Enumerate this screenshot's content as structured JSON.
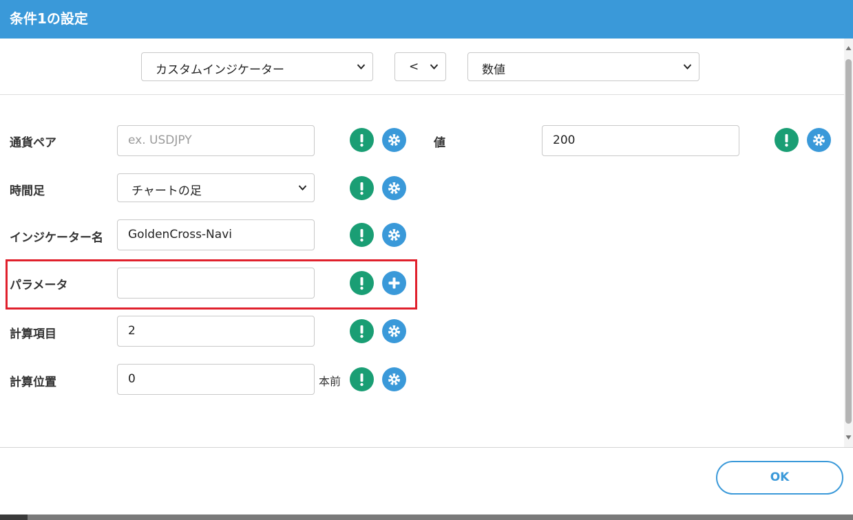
{
  "dialog": {
    "title": "条件1の設定"
  },
  "top_selects": {
    "indicator": "カスタムインジケーター",
    "operator": "<",
    "compare": "数値"
  },
  "left_rows": [
    {
      "label": "通貨ペア",
      "value": "",
      "placeholder": "ex. USDJPY",
      "type": "input",
      "action_icon": "gear-icon"
    },
    {
      "label": "時間足",
      "value": "チャートの足",
      "type": "select",
      "action_icon": "gear-icon"
    },
    {
      "label": "インジケーター名",
      "value": "GoldenCross-Navi",
      "type": "input",
      "action_icon": "gear-icon"
    },
    {
      "label": "パラメータ",
      "value": "",
      "type": "input",
      "action_icon": "plus-icon",
      "highlighted": true
    },
    {
      "label": "計算項目",
      "value": "2",
      "type": "input",
      "action_icon": "gear-icon"
    },
    {
      "label": "計算位置",
      "value": "0",
      "unit": "本前",
      "type": "input",
      "action_icon": "gear-icon"
    }
  ],
  "right_rows": [
    {
      "label": "値",
      "value": "200",
      "type": "input",
      "action_icon": "gear-icon"
    }
  ],
  "footer": {
    "ok_label": "OK"
  },
  "colors": {
    "accent_blue": "#3a99d9",
    "info_green": "#1a9e74",
    "highlight_red": "#e0202c"
  }
}
